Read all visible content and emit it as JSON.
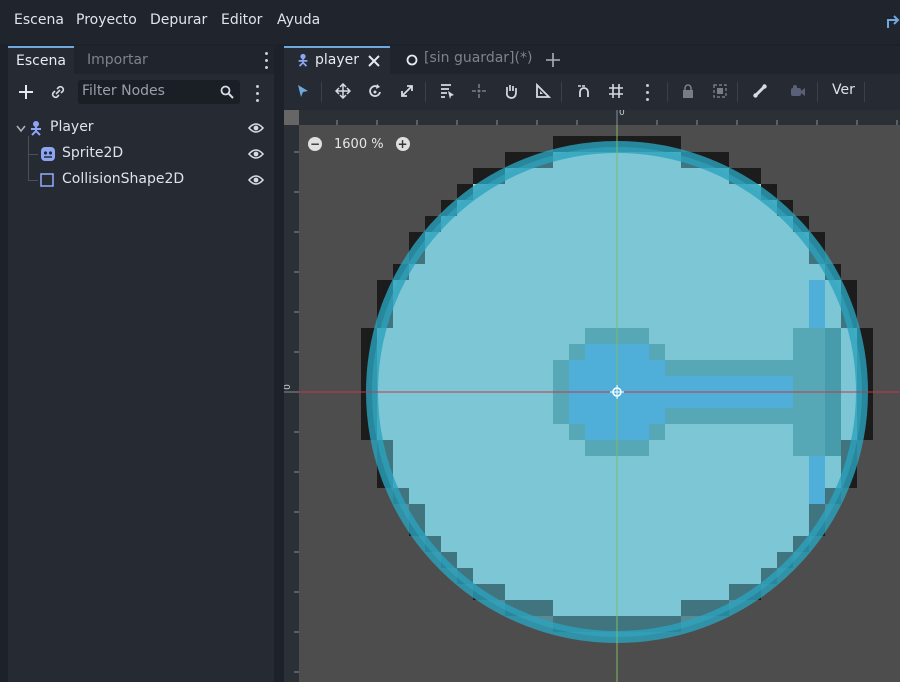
{
  "menubar": {
    "items": [
      "Escena",
      "Proyecto",
      "Depurar",
      "Editor",
      "Ayuda"
    ]
  },
  "scene_dock": {
    "tabs": [
      "Escena",
      "Importar"
    ],
    "filter_placeholder": "Filter Nodes",
    "nodes": [
      {
        "label": "Player",
        "icon": "character-body-icon"
      },
      {
        "label": "Sprite2D",
        "icon": "sprite-icon"
      },
      {
        "label": "CollisionShape2D",
        "icon": "collision-shape-icon"
      }
    ]
  },
  "editor": {
    "tabs": [
      {
        "label": "player",
        "icon": "character-body-icon",
        "active": true
      },
      {
        "label": "[sin guardar](*)",
        "icon": "circle-icon",
        "active": false
      }
    ],
    "view_label": "Ver",
    "zoom_label": "1600 %",
    "ruler_h_zero": "0",
    "ruler_v_zero": "0"
  },
  "colors": {
    "accent": "#6fa8dc",
    "viewport_bg": "#4d4d4d",
    "collision_fill": "#5fbfd3",
    "sprite_blue": "#3c9be0",
    "x_axis": "#c0394a",
    "y_axis": "#7dba6a"
  }
}
